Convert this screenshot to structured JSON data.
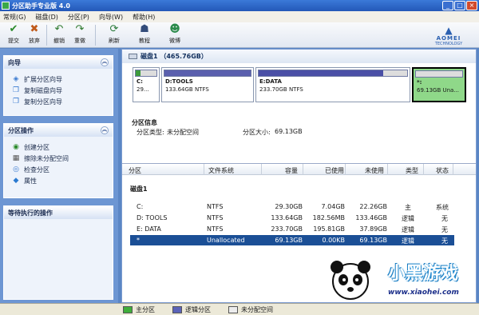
{
  "window": {
    "title": "分区助手专业版 4.0",
    "controls": [
      "_",
      "□",
      "×"
    ]
  },
  "menu": [
    "常规(G)",
    "磁盘(D)",
    "分区(P)",
    "向导(W)",
    "帮助(H)"
  ],
  "toolbar": [
    {
      "label": "提交",
      "icon": "check-icon"
    },
    {
      "label": "放弃",
      "icon": "discard-icon"
    },
    {
      "label": "撤销",
      "icon": "undo-icon"
    },
    {
      "label": "重做",
      "icon": "redo-icon"
    },
    {
      "label": "刷新",
      "icon": "refresh-icon"
    },
    {
      "label": "教程",
      "icon": "tutorial-icon"
    },
    {
      "label": "微博",
      "icon": "weibo-icon"
    }
  ],
  "brand": {
    "name": "AOMEI",
    "sub": "TECHNOLOGY"
  },
  "sidebar": {
    "wizard": {
      "title": "向导",
      "items": [
        "扩展分区向导",
        "复制磁盘向导",
        "复制分区向导"
      ]
    },
    "ops": {
      "title": "分区操作",
      "items": [
        "创建分区",
        "擦除未分配空间",
        "检查分区",
        "属性"
      ]
    },
    "pending": {
      "title": "等待执行的操作"
    }
  },
  "disk": {
    "header": "磁盘1 （465.76GB）",
    "partitions": [
      {
        "name": "C:",
        "size": "29...",
        "used_fraction": 0.24,
        "color": "#3c9b3c"
      },
      {
        "name": "D:TOOLS",
        "size": "133.64GB NTFS",
        "used_fraction": 1.0,
        "color": "#5a5fae"
      },
      {
        "name": "E:DATA",
        "size": "233.70GB NTFS",
        "used_fraction": 0.84,
        "color": "#4a4fa6"
      },
      {
        "name": "*:",
        "size": "69.13GB Una...",
        "used_fraction": 0.0,
        "color": "#e8e8e8"
      }
    ]
  },
  "info": {
    "title": "分区信息",
    "type_label": "分区类型:",
    "type_value": "未分配空间",
    "size_label": "分区大小:",
    "size_value": "69.13GB"
  },
  "table": {
    "columns": [
      "分区",
      "文件系统",
      "容量",
      "已使用",
      "未使用",
      "类型",
      "状态"
    ],
    "disk_label": "磁盘1",
    "rows": [
      {
        "name": "C:",
        "fs": "NTFS",
        "cap": "29.30GB",
        "used": "7.04GB",
        "free": "22.26GB",
        "type": "主",
        "status": "系统"
      },
      {
        "name": "D: TOOLS",
        "fs": "NTFS",
        "cap": "133.64GB",
        "used": "182.56MB",
        "free": "133.46GB",
        "type": "逻辑",
        "status": "无"
      },
      {
        "name": "E: DATA",
        "fs": "NTFS",
        "cap": "233.70GB",
        "used": "195.81GB",
        "free": "37.89GB",
        "type": "逻辑",
        "status": "无"
      },
      {
        "name": "*",
        "fs": "Unallocated",
        "cap": "69.13GB",
        "used": "0.00KB",
        "free": "69.13GB",
        "type": "逻辑",
        "status": "无"
      }
    ]
  },
  "legend": [
    {
      "label": "主分区",
      "color": "#3fae3a"
    },
    {
      "label": "逻辑分区",
      "color": "#5b63b8"
    },
    {
      "label": "未分配空间",
      "color": "#ececec"
    }
  ],
  "watermark": {
    "text": "小黑游戏",
    "url": "www.xiaohei.com"
  }
}
